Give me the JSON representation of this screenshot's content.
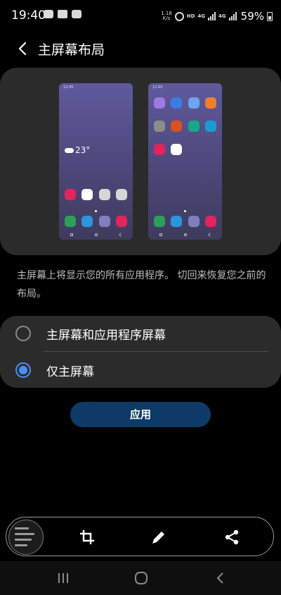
{
  "status_bar": {
    "time": "19:40",
    "net_speed_value": "1.18",
    "net_speed_unit": "K/s",
    "hd_label": "HD",
    "net_type_1": "4G",
    "net_type_2": "4G",
    "battery_percent": "59%",
    "left_icons": [
      "wechat-icon",
      "image-icon",
      "wechat-icon"
    ]
  },
  "header": {
    "title": "主屏幕布局"
  },
  "preview": {
    "left_phone": {
      "time": "12:45",
      "weather_temp": "23°"
    },
    "right_phone": {
      "time": "12:45"
    }
  },
  "description": "主屏幕上将显示您的所有应用程序。 切回来恢复您之前的布局。",
  "options": [
    {
      "label": "主屏幕和应用程序屏幕",
      "selected": false
    },
    {
      "label": "仅主屏幕",
      "selected": true
    }
  ],
  "apply_button": {
    "label": "应用"
  },
  "toolbar": {
    "icons": [
      "crop-icon",
      "pencil-icon",
      "share-icon"
    ]
  },
  "colors": {
    "accent": "#4a8ff5",
    "apply_button": "#0d3a66",
    "card_bg": "#2b2b2b"
  }
}
